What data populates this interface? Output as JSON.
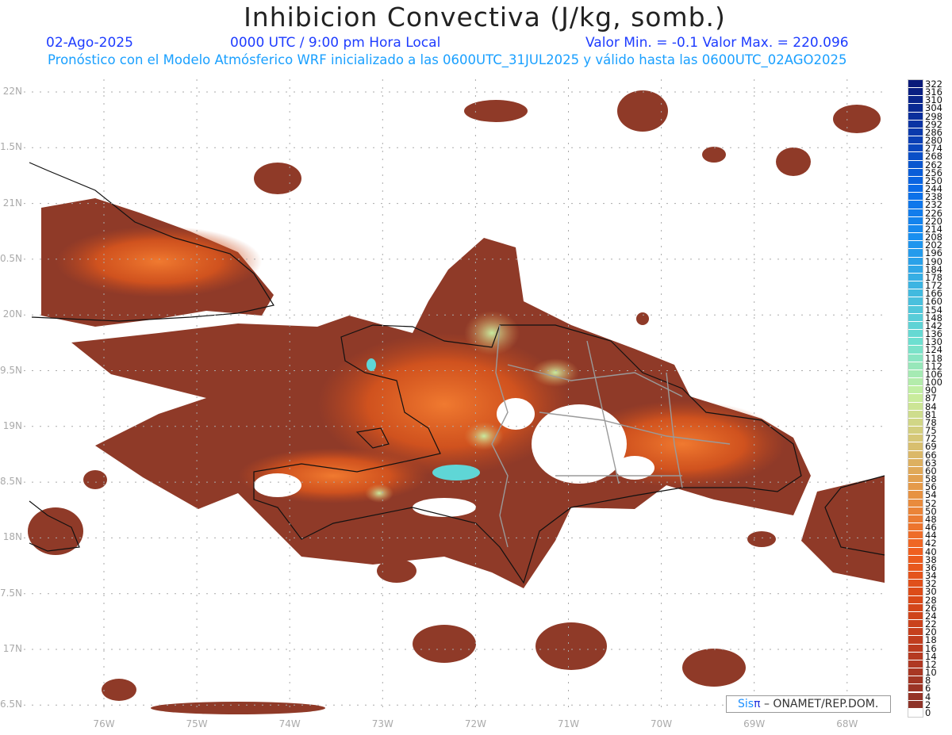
{
  "header": {
    "title": "Inhibicion Convectiva (J/kg, somb.)",
    "date": "02-Ago-2025",
    "time": "0000 UTC / 9:00 pm Hora Local",
    "minmax": "Valor Min. = -0.1  Valor Max. = 220.096",
    "description": "Pronóstico con el Modelo Atmósferico WRF inicializado a las 0600UTC_31JUL2025 y válido hasta las  0600UTC_02AGO2025"
  },
  "axes": {
    "lat_labels": [
      "22N",
      "1.5N",
      "21N",
      "0.5N",
      "20N",
      "9.5N",
      "19N",
      "8.5N",
      "18N",
      "7.5N",
      "17N",
      "6.5N"
    ],
    "lon_labels": [
      "76W",
      "75W",
      "74W",
      "73W",
      "72W",
      "71W",
      "70W",
      "69W",
      "68W"
    ]
  },
  "colorbar": {
    "labels": [
      "322",
      "316",
      "310",
      "304",
      "298",
      "292",
      "286",
      "280",
      "274",
      "268",
      "262",
      "256",
      "250",
      "244",
      "238",
      "232",
      "226",
      "220",
      "214",
      "208",
      "202",
      "196",
      "190",
      "184",
      "178",
      "172",
      "166",
      "160",
      "154",
      "148",
      "142",
      "136",
      "130",
      "124",
      "118",
      "112",
      "106",
      "100",
      "90",
      "87",
      "84",
      "81",
      "78",
      "75",
      "72",
      "69",
      "66",
      "63",
      "60",
      "58",
      "56",
      "54",
      "52",
      "50",
      "48",
      "46",
      "44",
      "42",
      "40",
      "38",
      "36",
      "34",
      "32",
      "30",
      "28",
      "26",
      "24",
      "22",
      "20",
      "18",
      "16",
      "14",
      "12",
      "10",
      "8",
      "6",
      "4",
      "2",
      "0"
    ],
    "color_stops": [
      "#0a1a7a",
      "#0a3cb0",
      "#0a6ae8",
      "#1a90f0",
      "#40b8e0",
      "#6ee0d0",
      "#c8f0a0",
      "#d8c070",
      "#e89040",
      "#f06020",
      "#d84818",
      "#b83a20",
      "#8e3328"
    ]
  },
  "credit": {
    "sis": "Sis",
    "pi": "π",
    "org": "– ONAMET/REP.DOM."
  },
  "colors": {
    "brown": "#8f3a28",
    "orange": "#e0581c",
    "green": "#c8eba0",
    "cyan": "#5fd6d6"
  }
}
